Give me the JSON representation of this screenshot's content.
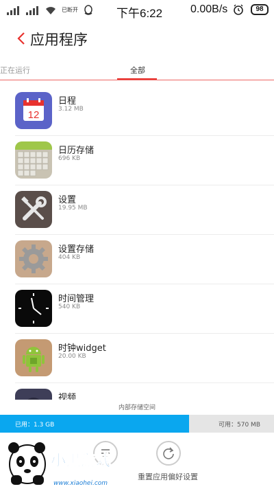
{
  "status_bar": {
    "carrier_text": "已断开",
    "time": "下午6:22",
    "network_speed": "0.00B/s",
    "battery_level": "98"
  },
  "header": {
    "title": "应用程序"
  },
  "tabs": [
    {
      "label": "正在运行",
      "active": false
    },
    {
      "label": "全部",
      "active": true
    }
  ],
  "apps": [
    {
      "name": "日程",
      "size": "3.12 MB",
      "icon": "calendar-icon"
    },
    {
      "name": "日历存储",
      "size": "696 KB",
      "icon": "calendar-storage-icon"
    },
    {
      "name": "设置",
      "size": "19.95 MB",
      "icon": "settings-tools-icon"
    },
    {
      "name": "设置存储",
      "size": "404 KB",
      "icon": "settings-storage-gear-icon"
    },
    {
      "name": "时间管理",
      "size": "540 KB",
      "icon": "clock-icon"
    },
    {
      "name": "时钟widget",
      "size": "20.00 KB",
      "icon": "android-widget-icon"
    },
    {
      "name": "视频",
      "size": "",
      "icon": "video-icon"
    }
  ],
  "calendar_icon_day": "12",
  "storage": {
    "label": "内部存储空间",
    "used": "已用：1.3 GB",
    "free": "可用：570 MB",
    "used_fraction": 0.69
  },
  "actions": {
    "reset_label": "重置应用偏好设置"
  },
  "watermark": {
    "text": "小黑游戏",
    "url": "www.xiaohei.com"
  },
  "colors": {
    "accent": "#e8322e",
    "storage_used": "#0aa7ef"
  }
}
